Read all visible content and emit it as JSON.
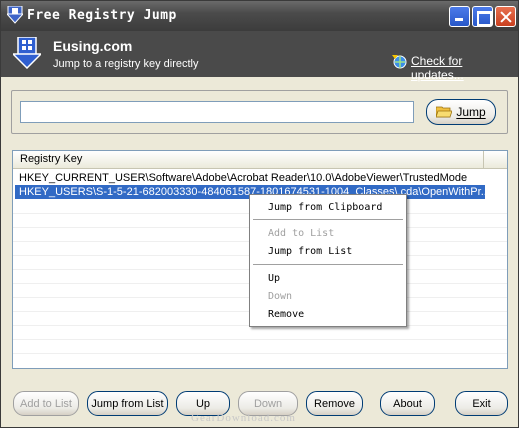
{
  "window": {
    "title": "Free Registry Jump"
  },
  "banner": {
    "brand": "Eusing.com",
    "tagline": "Jump to a registry key directly",
    "update_link": "Check for updates..."
  },
  "jump": {
    "input_value": "",
    "button_label": "Jump"
  },
  "list": {
    "column_header": "Registry Key",
    "rows": [
      {
        "key": "HKEY_CURRENT_USER\\Software\\Adobe\\Acrobat Reader\\10.0\\AdobeViewer\\TrustedMode",
        "selected": false
      },
      {
        "key": "HKEY_USERS\\S-1-5-21-682003330-484061587-1801674531-1004_Classes\\.cda\\OpenWithPr...",
        "selected": true
      }
    ]
  },
  "context_menu": {
    "items": [
      {
        "label": "Jump from Clipboard",
        "enabled": true
      },
      {
        "label": "Add to List",
        "enabled": false
      },
      {
        "label": "Jump from List",
        "enabled": true
      },
      {
        "label": "Up",
        "enabled": true
      },
      {
        "label": "Down",
        "enabled": false
      },
      {
        "label": "Remove",
        "enabled": true
      }
    ]
  },
  "buttons": {
    "add_to_list": "Add to List",
    "jump_from_list": "Jump from List",
    "up": "Up",
    "down": "Down",
    "remove": "Remove",
    "about": "About",
    "exit": "Exit"
  },
  "watermark": "GearDownload.com",
  "colors": {
    "selection": "#316ac5",
    "banner": "#4a4a4a",
    "titlebar": "#4b4b4b"
  },
  "icons": {
    "app": "registry-arrow-icon",
    "update": "globe-update-icon",
    "jump": "folder-open-icon"
  }
}
